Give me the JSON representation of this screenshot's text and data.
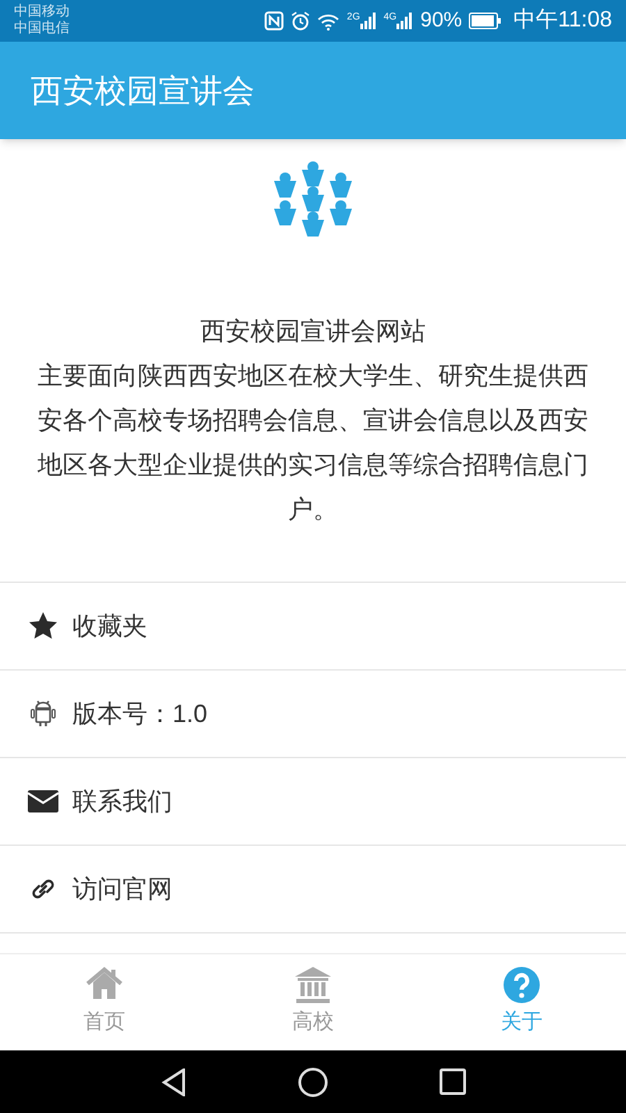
{
  "status_bar": {
    "carriers": [
      "中国移动",
      "中国电信"
    ],
    "signal_labels": [
      "2G",
      "4G"
    ],
    "battery": "90%",
    "time": "中午11:08"
  },
  "app_bar": {
    "title": "西安校园宣讲会"
  },
  "about": {
    "title": "西安校园宣讲会网站",
    "description": "主要面向陕西西安地区在校大学生、研究生提供西安各个高校专场招聘会信息、宣讲会信息以及西安地区各大型企业提供的实习信息等综合招聘信息门户。"
  },
  "menu": [
    {
      "kind": "star",
      "label": "收藏夹"
    },
    {
      "kind": "android",
      "label": "版本号：1.0"
    },
    {
      "kind": "mail",
      "label": "联系我们"
    },
    {
      "kind": "link",
      "label": "访问官网"
    }
  ],
  "tabs": [
    {
      "kind": "home",
      "label": "首页",
      "selected": false
    },
    {
      "kind": "bank",
      "label": "高校",
      "selected": false
    },
    {
      "kind": "help",
      "label": "关于",
      "selected": true
    }
  ]
}
